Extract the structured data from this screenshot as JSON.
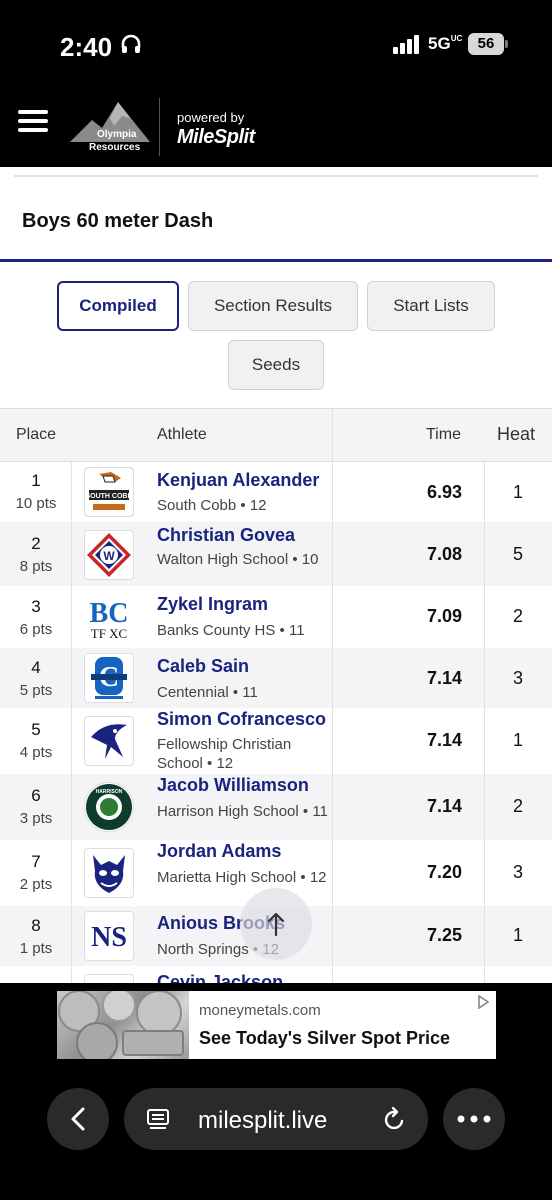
{
  "status": {
    "time": "2:40",
    "network": "5G",
    "network_sub": "UC",
    "battery": "56"
  },
  "header": {
    "logo_line1": "Olympia",
    "logo_line2": "Resources",
    "powered_by": "powered by",
    "brand": "MileSplit"
  },
  "page": {
    "title": "Boys 60 meter Dash"
  },
  "tabs": [
    {
      "label": "Compiled",
      "active": true
    },
    {
      "label": "Section Results",
      "active": false
    },
    {
      "label": "Start Lists",
      "active": false
    },
    {
      "label": "Seeds",
      "active": false
    }
  ],
  "table": {
    "headers": {
      "place": "Place",
      "athlete": "Athlete",
      "time": "Time",
      "heat": "Heat"
    },
    "rows": [
      {
        "place": "1",
        "pts": "10 pts",
        "name": "Kenjuan Alexander",
        "school": "South Cobb • 12",
        "time": "6.93",
        "heat": "1"
      },
      {
        "place": "2",
        "pts": "8 pts",
        "name": "Christian Govea",
        "school": "Walton High School • 10",
        "time": "7.08",
        "heat": "5"
      },
      {
        "place": "3",
        "pts": "6 pts",
        "name": "Zykel Ingram",
        "school": "Banks County HS • 11",
        "time": "7.09",
        "heat": "2"
      },
      {
        "place": "4",
        "pts": "5 pts",
        "name": "Caleb Sain",
        "school": "Centennial • 11",
        "time": "7.14",
        "heat": "3"
      },
      {
        "place": "5",
        "pts": "4 pts",
        "name": "Simon Cofrancesco",
        "school": "Fellowship Christian School • 12",
        "time": "7.14",
        "heat": "1"
      },
      {
        "place": "6",
        "pts": "3 pts",
        "name": "Jacob Williamson",
        "school": "Harrison High School • 11",
        "time": "7.14",
        "heat": "2"
      },
      {
        "place": "7",
        "pts": "2 pts",
        "name": "Jordan Adams",
        "school": "Marietta High School • 12",
        "time": "7.20",
        "heat": "3"
      },
      {
        "place": "8",
        "pts": "1 pts",
        "name": "Anious Brooks",
        "school": "North Springs • 12",
        "time": "7.25",
        "heat": "1"
      },
      {
        "place": "",
        "pts": "",
        "name": "Cevin Jackson",
        "school": "",
        "time": "",
        "heat": ""
      }
    ]
  },
  "logos": {
    "south_cobb": "SOUTH COBB",
    "banks": "BC",
    "banks_sub": "TF XC",
    "centennial": "C",
    "marietta": "",
    "north_springs": "NS",
    "harrison": "HARRISON"
  },
  "ad": {
    "domain": "moneymetals.com",
    "headline": "See Today's Silver Spot Price"
  },
  "browser": {
    "url": "milesplit.live"
  },
  "colors": {
    "accent": "#1a237e",
    "row_alt": "#f4f4f7"
  }
}
